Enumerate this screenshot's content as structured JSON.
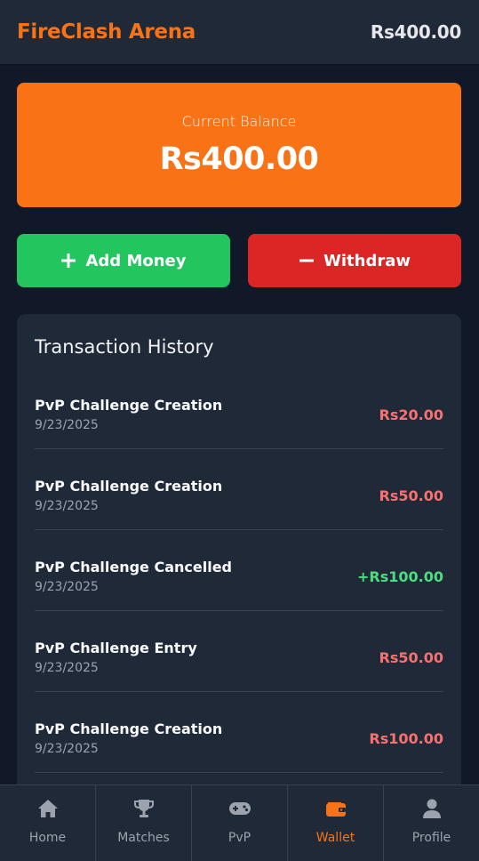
{
  "header": {
    "brand": "FireClash Arena",
    "balance": "Rs400.00"
  },
  "balance_card": {
    "label": "Current Balance",
    "amount": "Rs400.00"
  },
  "actions": {
    "add_label": "Add Money",
    "add_icon": "plus-icon",
    "withdraw_label": "Withdraw",
    "withdraw_icon": "minus-icon"
  },
  "history": {
    "title": "Transaction History",
    "items": [
      {
        "title": "PvP Challenge Creation",
        "date": "9/23/2025",
        "amount": "Rs20.00",
        "type": "debit"
      },
      {
        "title": "PvP Challenge Creation",
        "date": "9/23/2025",
        "amount": "Rs50.00",
        "type": "debit"
      },
      {
        "title": "PvP Challenge Cancelled",
        "date": "9/23/2025",
        "amount": "+Rs100.00",
        "type": "credit"
      },
      {
        "title": "PvP Challenge Entry",
        "date": "9/23/2025",
        "amount": "Rs50.00",
        "type": "debit"
      },
      {
        "title": "PvP Challenge Creation",
        "date": "9/23/2025",
        "amount": "Rs100.00",
        "type": "debit"
      }
    ]
  },
  "nav": {
    "items": [
      {
        "label": "Home",
        "icon": "home-icon"
      },
      {
        "label": "Matches",
        "icon": "trophy-icon"
      },
      {
        "label": "PvP",
        "icon": "gamepad-icon"
      },
      {
        "label": "Wallet",
        "icon": "wallet-icon",
        "active": true
      },
      {
        "label": "Profile",
        "icon": "user-icon"
      }
    ]
  },
  "colors": {
    "accent": "#f97316",
    "add_button": "#22c55e",
    "withdraw_button": "#dc2626",
    "debit_amount": "#f87171",
    "credit_amount": "#4ade80"
  }
}
